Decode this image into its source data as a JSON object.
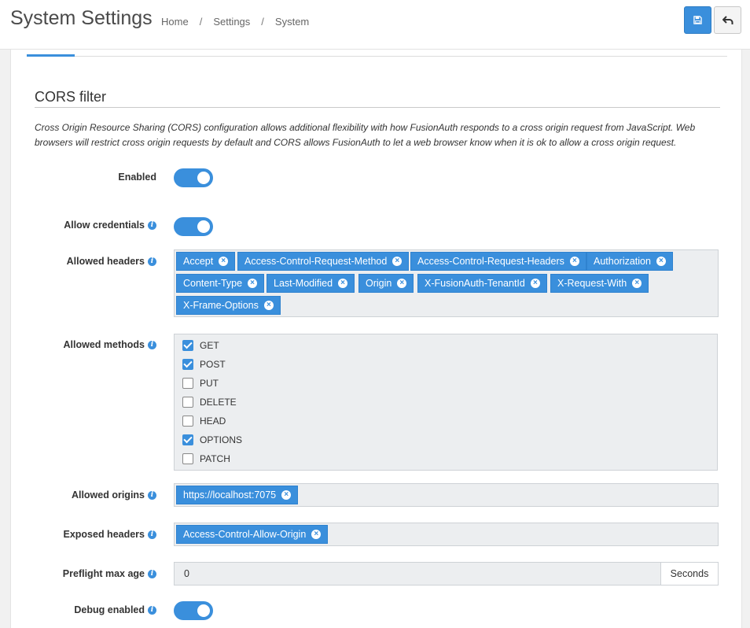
{
  "header": {
    "title": "System Settings",
    "breadcrumb": [
      "Home",
      "Settings",
      "System"
    ],
    "breadcrumb_sep": "/"
  },
  "section": {
    "title": "CORS filter",
    "description": "Cross Origin Resource Sharing (CORS) configuration allows additional flexibility with how FusionAuth responds to a cross origin request from JavaScript. Web browsers will restrict cross origin requests by default and CORS allows FusionAuth to let a web browser know when it is ok to allow a cross origin request."
  },
  "fields": {
    "enabled": {
      "label": "Enabled",
      "value": true
    },
    "allow_credentials": {
      "label": "Allow credentials",
      "value": true
    },
    "allowed_headers": {
      "label": "Allowed headers",
      "tags": [
        "Accept",
        "Access-Control-Request-Method",
        "Access-Control-Request-Headers",
        "Authorization",
        "Content-Type",
        "Last-Modified",
        "Origin",
        "X-FusionAuth-TenantId",
        "X-Request-With",
        "X-Frame-Options"
      ]
    },
    "allowed_methods": {
      "label": "Allowed methods",
      "options": [
        {
          "name": "GET",
          "checked": true
        },
        {
          "name": "POST",
          "checked": true
        },
        {
          "name": "PUT",
          "checked": false
        },
        {
          "name": "DELETE",
          "checked": false
        },
        {
          "name": "HEAD",
          "checked": false
        },
        {
          "name": "OPTIONS",
          "checked": true
        },
        {
          "name": "PATCH",
          "checked": false
        }
      ]
    },
    "allowed_origins": {
      "label": "Allowed origins",
      "tags": [
        "https://localhost:7075"
      ]
    },
    "exposed_headers": {
      "label": "Exposed headers",
      "tags": [
        "Access-Control-Allow-Origin"
      ]
    },
    "preflight_max_age": {
      "label": "Preflight max age",
      "value": "0",
      "unit": "Seconds"
    },
    "debug_enabled": {
      "label": "Debug enabled",
      "value": true
    }
  },
  "colors": {
    "accent": "#3a8fdc"
  },
  "icons": {
    "save": "save-icon",
    "back": "undo-icon",
    "info": "info-icon",
    "remove": "remove-tag-icon"
  }
}
